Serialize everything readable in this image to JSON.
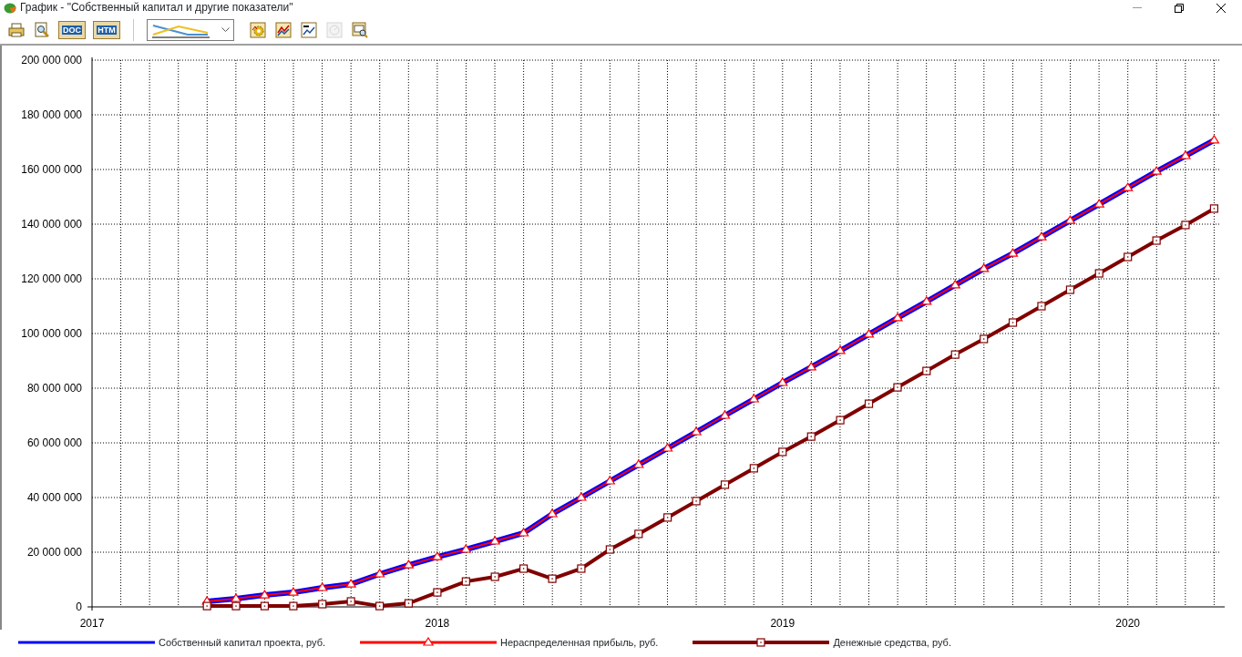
{
  "window": {
    "title": "График - \"Собственный капитал и другие показатели\""
  },
  "toolbar": {
    "buttons": [
      {
        "kind": "print",
        "disabled": false
      },
      {
        "kind": "preview",
        "disabled": false
      },
      {
        "kind": "export",
        "tag": "DOC",
        "disabled": false
      },
      {
        "kind": "export",
        "tag": "HTM",
        "disabled": false
      },
      {
        "kind": "chart-type",
        "disabled": false
      },
      {
        "kind": "settings",
        "disabled": false
      },
      {
        "kind": "lines",
        "disabled": false
      },
      {
        "kind": "numbers",
        "disabled": false
      },
      {
        "kind": "gauge",
        "disabled": true
      },
      {
        "kind": "zoom",
        "disabled": false
      }
    ]
  },
  "chart_data": {
    "type": "line",
    "grid": true,
    "xlim": [
      2017,
      2020.27
    ],
    "ylim": [
      0,
      200000000
    ],
    "xticks": [
      2017,
      2018,
      2019,
      2020
    ],
    "yticks": [
      {
        "value": 0,
        "label": "0"
      },
      {
        "value": 20000000,
        "label": "20 000 000"
      },
      {
        "value": 40000000,
        "label": "40 000 000"
      },
      {
        "value": 60000000,
        "label": "60 000 000"
      },
      {
        "value": 80000000,
        "label": "80 000 000"
      },
      {
        "value": 100000000,
        "label": "100 000 000"
      },
      {
        "value": 120000000,
        "label": "120 000 000"
      },
      {
        "value": 140000000,
        "label": "140 000 000"
      },
      {
        "value": 160000000,
        "label": "160 000 000"
      },
      {
        "value": 180000000,
        "label": "180 000 000"
      },
      {
        "value": 200000000,
        "label": "200 000 000"
      }
    ],
    "x": [
      2017.333,
      2017.417,
      2017.5,
      2017.583,
      2017.667,
      2017.75,
      2017.833,
      2017.917,
      2018,
      2018.083,
      2018.167,
      2018.25,
      2018.333,
      2018.417,
      2018.5,
      2018.583,
      2018.667,
      2018.75,
      2018.833,
      2018.917,
      2019,
      2019.083,
      2019.167,
      2019.25,
      2019.333,
      2019.417,
      2019.5,
      2019.583,
      2019.667,
      2019.75,
      2019.833,
      2019.917,
      2020,
      2020.083,
      2020.167,
      2020.25
    ],
    "series": [
      {
        "name": "Собственный капитал проекта, руб.",
        "color": "#0000ff",
        "marker": "none",
        "values": [
          2000000,
          3000000,
          4300000,
          5300000,
          7000000,
          8300000,
          12000000,
          15300000,
          18300000,
          21000000,
          24000000,
          27000000,
          34000000,
          40000000,
          46000000,
          52000000,
          58000000,
          64000000,
          70000000,
          76000000,
          82000000,
          87700000,
          93700000,
          99700000,
          105700000,
          111700000,
          117700000,
          123700000,
          129300000,
          135300000,
          141300000,
          147300000,
          153300000,
          159300000,
          165000000,
          170700000
        ]
      },
      {
        "name": "Нераспределенная прибыль, руб.",
        "color": "#ff0000",
        "marker": "triangle",
        "values": [
          2000000,
          3000000,
          4300000,
          5300000,
          7000000,
          8300000,
          12000000,
          15300000,
          18300000,
          21000000,
          24000000,
          27000000,
          34000000,
          40000000,
          46000000,
          52000000,
          58000000,
          64000000,
          70000000,
          76000000,
          82000000,
          87700000,
          93700000,
          99700000,
          105700000,
          111700000,
          117700000,
          123700000,
          129300000,
          135300000,
          141300000,
          147300000,
          153300000,
          159300000,
          165000000,
          170700000
        ]
      },
      {
        "name": "Денежные средства, руб.",
        "color": "#800000",
        "marker": "square",
        "values": [
          300000,
          300000,
          300000,
          300000,
          1000000,
          2000000,
          300000,
          1300000,
          5300000,
          9300000,
          11000000,
          14000000,
          10300000,
          14000000,
          21000000,
          26700000,
          32700000,
          38700000,
          44700000,
          50700000,
          56700000,
          62300000,
          68300000,
          74300000,
          80300000,
          86300000,
          92300000,
          98000000,
          104000000,
          110000000,
          116000000,
          122000000,
          128000000,
          134000000,
          139700000,
          145700000
        ]
      }
    ]
  }
}
